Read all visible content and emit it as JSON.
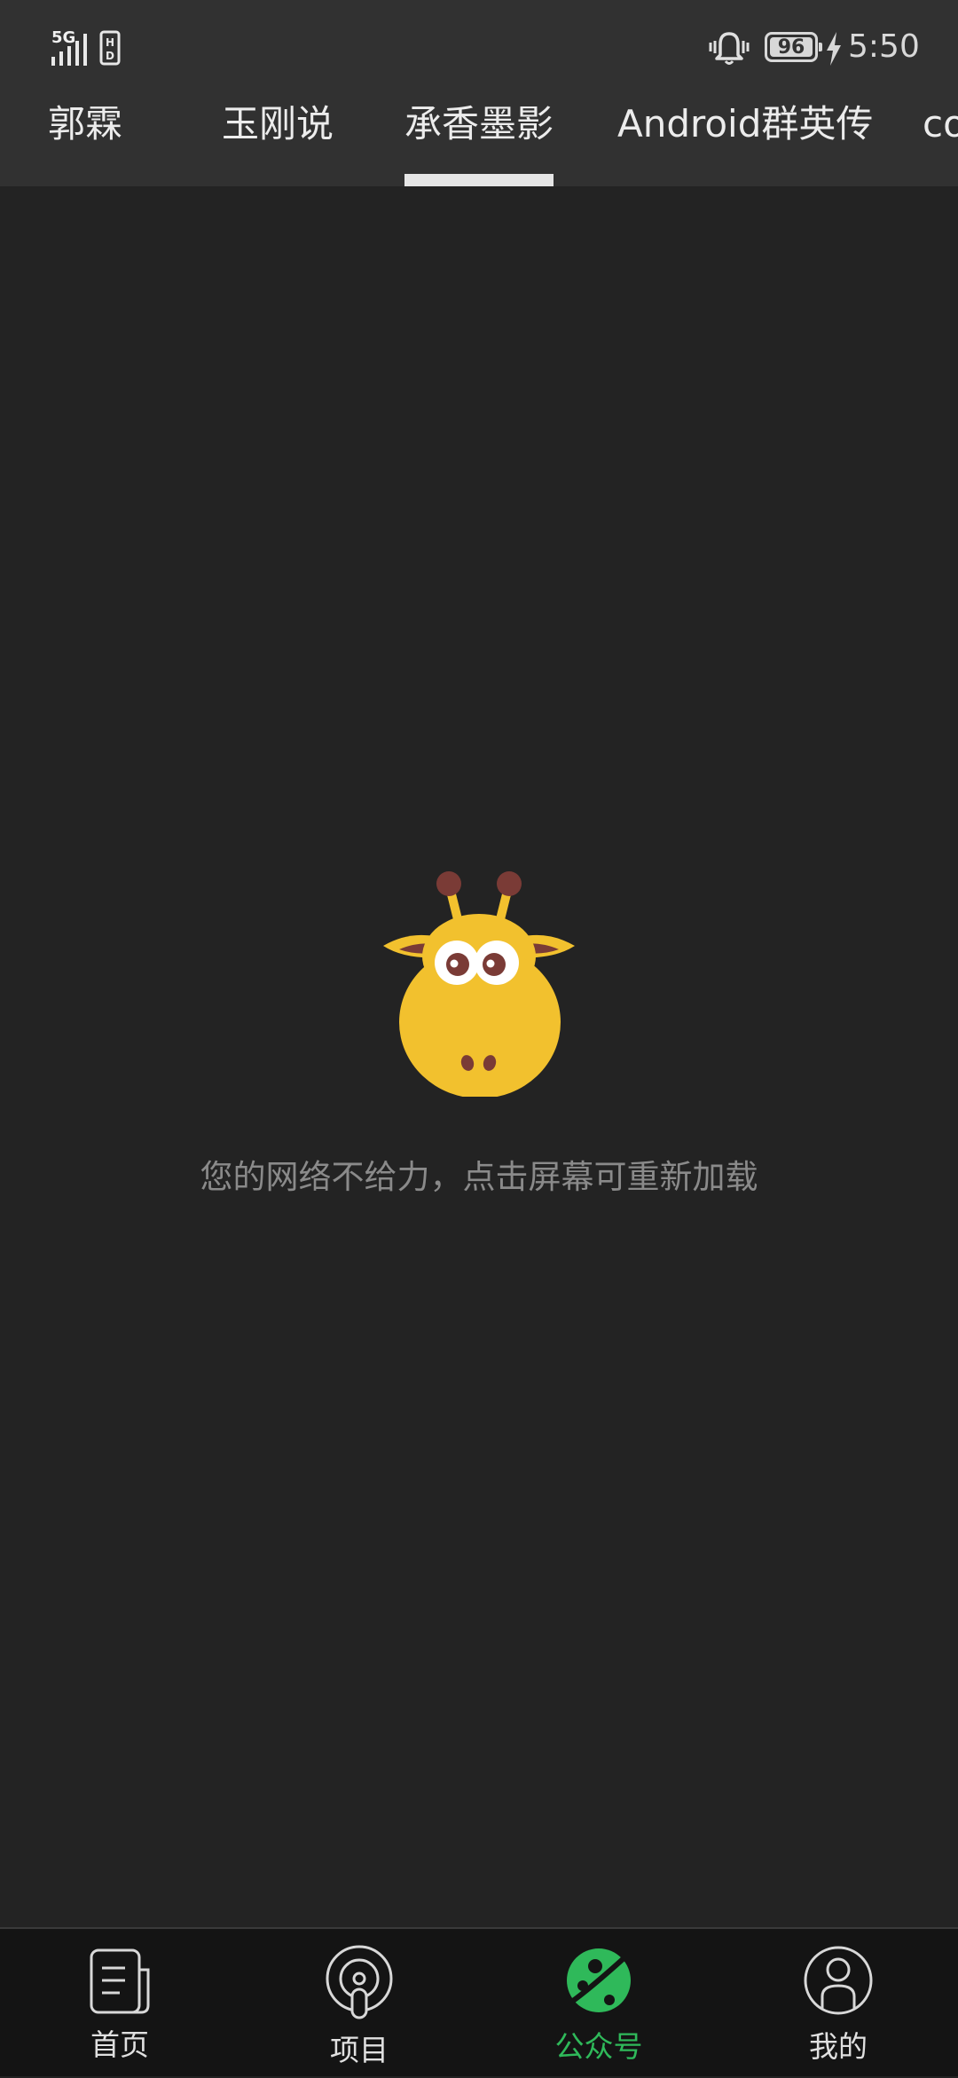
{
  "status_bar": {
    "network": "5G",
    "signal_icon": "signal-bars-icon",
    "sim_icon": "sim-card-icon",
    "alarm_icon": "bell-icon",
    "battery": "96",
    "charging_icon": "charging-bolt-icon",
    "time": "5:50"
  },
  "tabs": [
    {
      "label": "郭霖",
      "active": false
    },
    {
      "label": "玉刚说",
      "active": false
    },
    {
      "label": "承香墨影",
      "active": true
    },
    {
      "label": "Android群英传",
      "active": false
    },
    {
      "label": "co",
      "active": false
    }
  ],
  "empty_state": {
    "illustration": "giraffe-icon",
    "message": "您的网络不给力，点击屏幕可重新加载"
  },
  "bottom_nav": [
    {
      "label": "首页",
      "icon": "document-icon",
      "active": false
    },
    {
      "label": "项目",
      "icon": "target-pin-icon",
      "active": false
    },
    {
      "label": "公众号",
      "icon": "planet-icon",
      "active": true
    },
    {
      "label": "我的",
      "icon": "user-icon",
      "active": false
    }
  ],
  "colors": {
    "background": "#232323",
    "header": "#313131",
    "accent": "#2fb95a",
    "giraffe": "#f2c12e"
  }
}
